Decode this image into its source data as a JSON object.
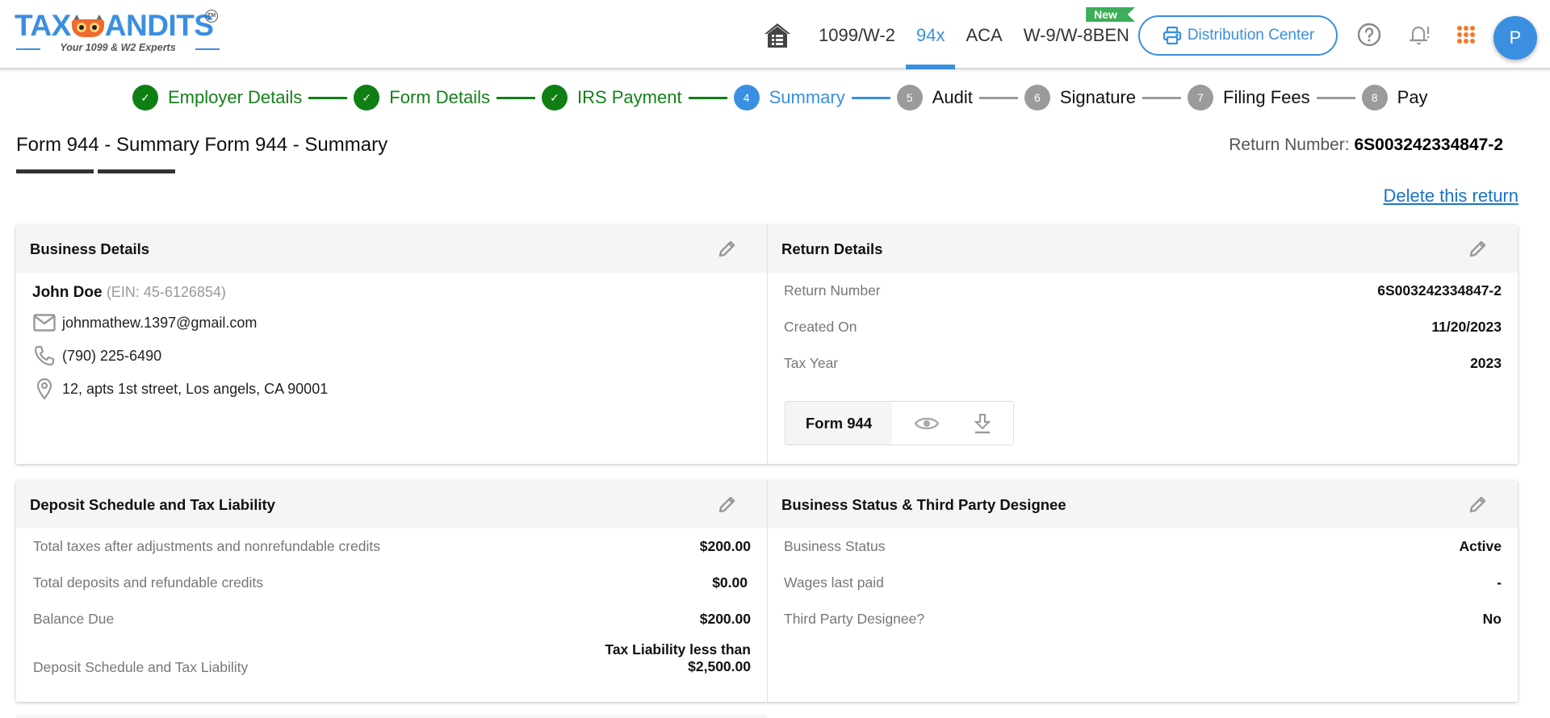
{
  "header": {
    "logo": {
      "text_left": "TAX",
      "text_right": "ANDITS",
      "tm": "TM",
      "tagline": "Your 1099 & W2 Experts"
    },
    "nav": [
      {
        "label": "1099/W-2",
        "active": false
      },
      {
        "label": "94x",
        "active": true
      },
      {
        "label": "ACA",
        "active": false
      },
      {
        "label": "W-9/W-8BEN",
        "active": false,
        "badge": "New"
      }
    ],
    "distribution_center": "Distribution Center",
    "icons": [
      "home-icon",
      "printer-icon",
      "help-icon",
      "notification-bell-icon",
      "apps-grid-icon"
    ],
    "avatar_initial": "P",
    "colors": {
      "brand_blue": "#3a8fe0",
      "logo_orange": "#f0692e",
      "new_badge": "#3dad5a",
      "apps_orange": "#f07a2e"
    }
  },
  "stepper": {
    "steps": [
      {
        "num": "1",
        "label": "Employer Details",
        "state": "done"
      },
      {
        "num": "2",
        "label": "Form Details",
        "state": "done"
      },
      {
        "num": "3",
        "label": "IRS Payment",
        "state": "done"
      },
      {
        "num": "4",
        "label": "Summary",
        "state": "current"
      },
      {
        "num": "5",
        "label": "Audit",
        "state": "todo"
      },
      {
        "num": "6",
        "label": "Signature",
        "state": "todo"
      },
      {
        "num": "7",
        "label": "Filing Fees",
        "state": "todo"
      },
      {
        "num": "8",
        "label": "Pay",
        "state": "todo"
      }
    ],
    "colors": {
      "done": "#0f7f14",
      "current": "#3a8fe0",
      "todo": "#9b9b9b"
    }
  },
  "page": {
    "title": "Form 944 - Summary Form 944 - Summary",
    "return_number_label": "Return Number:",
    "return_number_value": "6S003242334847-2",
    "delete_link": "Delete this return"
  },
  "business_details": {
    "title": "Business Details",
    "name": "John Doe",
    "ein": "(EIN: 45-6126854)",
    "email": "johnmathew.1397@gmail.com",
    "phone": "(790) 225-6490",
    "address": "12, apts 1st street, Los angels, CA 90001"
  },
  "return_details": {
    "title": "Return Details",
    "rows": [
      {
        "label": "Return Number",
        "value": "6S003242334847-2"
      },
      {
        "label": "Created On",
        "value": "11/20/2023"
      },
      {
        "label": "Tax Year",
        "value": "2023"
      }
    ],
    "form_chip": "Form 944"
  },
  "deposit_schedule": {
    "title": "Deposit Schedule and Tax Liability",
    "rows": [
      {
        "label": "Total taxes after adjustments and nonrefundable credits",
        "value": "$200.00"
      },
      {
        "label": "Total deposits and refundable credits",
        "value": "$0.00"
      },
      {
        "label": "Balance Due",
        "value": "$200.00"
      },
      {
        "label": "Deposit Schedule and Tax Liability",
        "value_line1": "Tax Liability less than",
        "value_line2": "$2,500.00"
      }
    ]
  },
  "business_status": {
    "title": "Business Status & Third Party Designee",
    "rows": [
      {
        "label": "Business Status",
        "value": "Active"
      },
      {
        "label": "Wages last paid",
        "value": "-"
      },
      {
        "label": "Third Party Designee?",
        "value": "No"
      }
    ]
  }
}
